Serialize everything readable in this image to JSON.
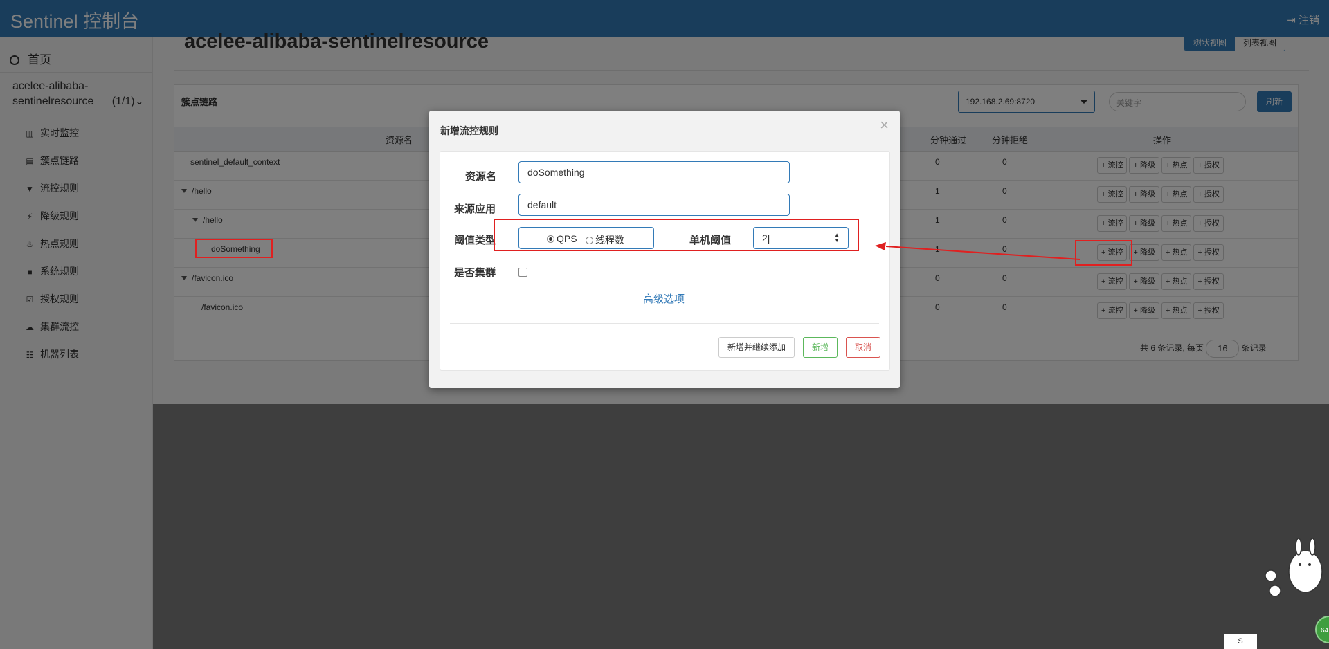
{
  "app": {
    "brand": "Sentinel 控制台",
    "logout": "注销"
  },
  "sidebar": {
    "home": "首页",
    "app_name": "acelee-alibaba-sentinelresource",
    "app_count": "(1/1)",
    "items": [
      {
        "label": "实时监控",
        "icon": "bar-chart-icon"
      },
      {
        "label": "簇点链路",
        "icon": "list-icon"
      },
      {
        "label": "流控规则",
        "icon": "filter-icon"
      },
      {
        "label": "降级规则",
        "icon": "bolt-icon"
      },
      {
        "label": "热点规则",
        "icon": "fire-icon"
      },
      {
        "label": "系统规则",
        "icon": "lock-icon"
      },
      {
        "label": "授权规则",
        "icon": "check-square-icon"
      },
      {
        "label": "集群流控",
        "icon": "cloud-icon"
      },
      {
        "label": "机器列表",
        "icon": "th-list-icon"
      }
    ]
  },
  "main": {
    "title": "acelee-alibaba-sentinelresource",
    "view_tabs": [
      "树状视图",
      "列表视图"
    ],
    "panel_title": "簇点链路",
    "machine": "192.168.2.69:8720",
    "keyword_placeholder": "关键字",
    "refresh": "刷新",
    "columns": {
      "resource": "资源名",
      "pass": "分钟通过",
      "block": "分钟拒绝",
      "ops": "操作"
    },
    "rows": [
      {
        "name": "sentinel_default_context",
        "pass": "0",
        "block": "0"
      },
      {
        "name": "/hello",
        "pass": "1",
        "block": "0"
      },
      {
        "name": "/hello",
        "pass": "1",
        "block": "0"
      },
      {
        "name": "doSomething",
        "pass": "1",
        "block": "0"
      },
      {
        "name": "/favicon.ico",
        "pass": "0",
        "block": "0"
      },
      {
        "name": "/favicon.ico",
        "pass": "0",
        "block": "0"
      }
    ],
    "op_buttons": {
      "flow": "+ 流控",
      "degrade": "+ 降级",
      "hot": "+ 热点",
      "auth": "+ 授权"
    },
    "pager": {
      "prefix": "共 6 条记录, 每页",
      "page_size": "16",
      "suffix": "条记录"
    }
  },
  "modal": {
    "title": "新增流控规则",
    "close": "×",
    "resource_label": "资源名",
    "resource_value": "doSomething",
    "origin_label": "来源应用",
    "origin_value": "default",
    "grade_label": "阈值类型",
    "grade_qps": "QPS",
    "grade_thread": "线程数",
    "threshold_label": "单机阈值",
    "threshold_value": "2",
    "cluster_label": "是否集群",
    "advanced": "高级选项",
    "btn_add_continue": "新增并继续添加",
    "btn_add": "新增",
    "btn_cancel": "取消"
  },
  "annotation": {
    "color": "#e02020"
  },
  "widgets": {
    "ball_text": "64",
    "tray_text": "S"
  }
}
